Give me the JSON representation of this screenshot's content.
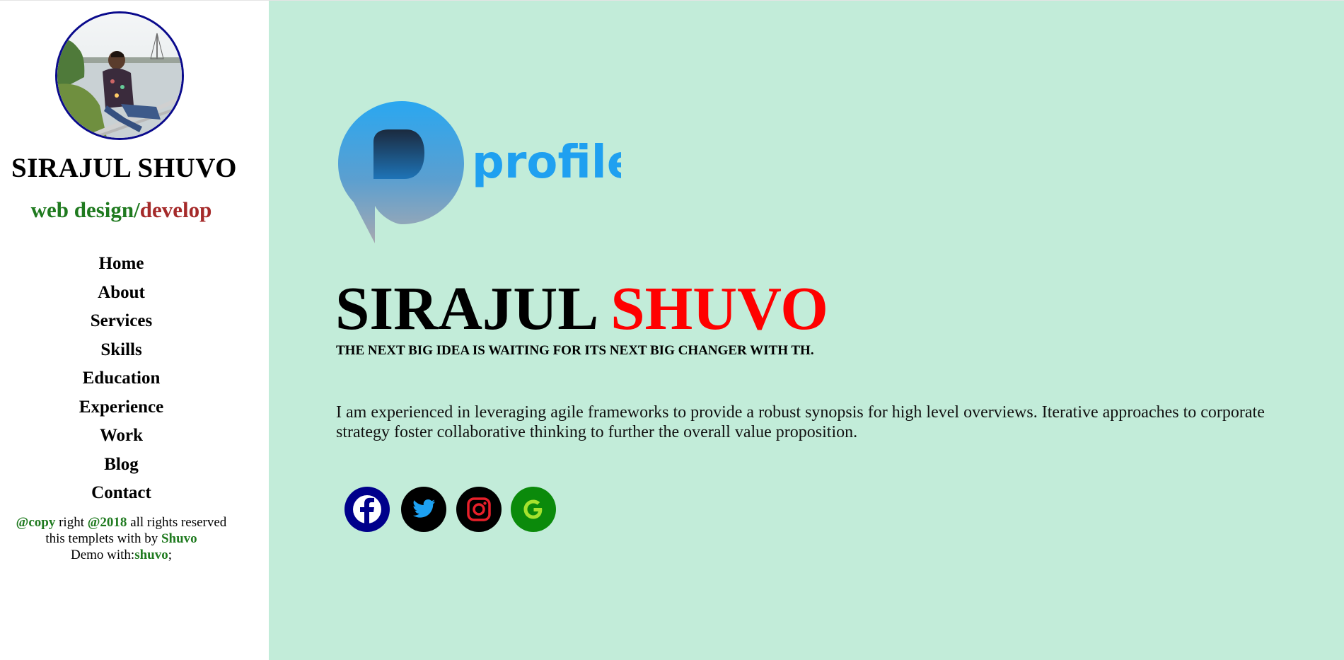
{
  "sidebar": {
    "name": "SIRAJUL SHUVO",
    "role_part1": "web design/",
    "role_part2": "develop",
    "nav": [
      "Home",
      "About",
      "Services",
      "Skills",
      "Education",
      "Experience",
      "Work",
      "Blog",
      "Contact"
    ],
    "footer": {
      "line1_a": "@copy",
      "line1_b": " right ",
      "line1_c": "@2018",
      "line1_d": " all rights reserved",
      "line2_a": "this templets with by ",
      "line2_b": "Shuvo",
      "line3_a": "Demo with:",
      "line3_b": "shuvo",
      "line3_c": ";"
    }
  },
  "main": {
    "logo_text": "profile",
    "headline_first": "SIRAJUL ",
    "headline_last": "SHUVO",
    "tagline": "THE NEXT BIG IDEA IS WAITING FOR ITS NEXT BIG CHANGER WITH TH.",
    "bio": "I am experienced in leveraging agile frameworks to provide a robust synopsis for high level overviews. Iterative approaches to corporate strategy foster collaborative thinking to further the overall value proposition.",
    "socials": [
      {
        "name": "facebook-icon",
        "color": "#00008b"
      },
      {
        "name": "twitter-icon",
        "color": "#000000"
      },
      {
        "name": "instagram-icon",
        "color": "#000000"
      },
      {
        "name": "google-icon",
        "color": "#0b8a0b"
      }
    ]
  },
  "colors": {
    "main_bg": "#c2ecd9",
    "accent_red": "#ff0000",
    "accent_green": "#1f7a1f",
    "accent_brown": "#a52a2a",
    "avatar_border": "#0a0a8c"
  }
}
